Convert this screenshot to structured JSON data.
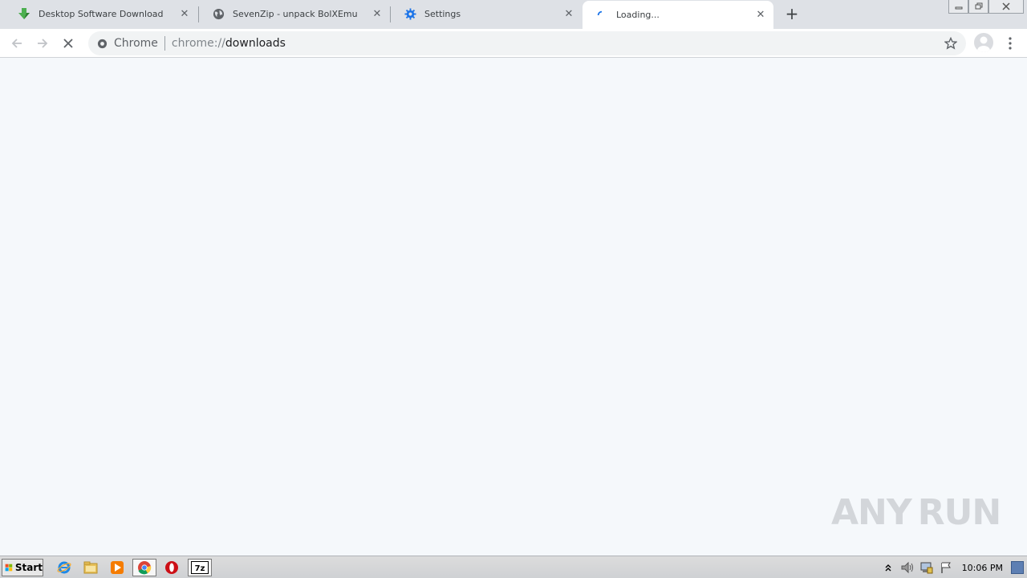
{
  "browser": {
    "tabs": [
      {
        "title": "Desktop Software Download",
        "icon": "download-arrow-icon"
      },
      {
        "title": "SevenZip - unpack BolXEmu",
        "icon": "globe-icon"
      },
      {
        "title": "Settings",
        "icon": "gear-icon"
      },
      {
        "title": "Loading...",
        "icon": "loading-spinner-icon",
        "active": true
      }
    ],
    "omnibox": {
      "chip": "Chrome",
      "url_scheme": "chrome://",
      "url_path": "downloads"
    }
  },
  "watermark": {
    "left": "ANY",
    "right": "RUN"
  },
  "taskbar": {
    "start_label": "Start",
    "apps": [
      "internet-explorer-icon",
      "file-explorer-icon",
      "media-player-icon",
      "chrome-icon",
      "opera-icon",
      "7zip-icon"
    ],
    "app_7zip_label": "7z",
    "clock": "10:06 PM"
  },
  "colors": {
    "tab_strip": "#dee1e6",
    "content_bg": "#f5f8fb",
    "accent": "#1a73e8"
  }
}
